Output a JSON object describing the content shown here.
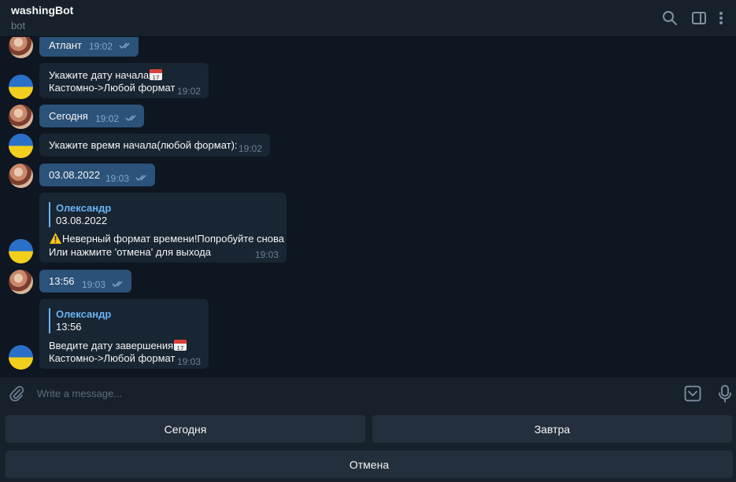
{
  "header": {
    "title": "washingBot",
    "subtitle": "bot"
  },
  "messages": [
    {
      "dir": "out",
      "text": "Атлант",
      "time": "19:02"
    },
    {
      "dir": "in",
      "lines": [
        "Укажите дату начала",
        "Кастомно->Любой формат"
      ],
      "time": "19:02",
      "emoji": "calendar-icon"
    },
    {
      "dir": "out",
      "text": "Сегодня",
      "time": "19:02"
    },
    {
      "dir": "in",
      "lines": [
        "Укажите время начала(любой формат):"
      ],
      "time": "19:02"
    },
    {
      "dir": "out",
      "text": "03.08.2022",
      "time": "19:03"
    },
    {
      "dir": "in",
      "reply_name": "Олександр",
      "reply_text": "03.08.2022",
      "lines": [
        "Неверный формат времени!Попробуйте снова",
        "Или нажмите 'отмена' для выхода"
      ],
      "time": "19:03",
      "emoji": "warning-icon"
    },
    {
      "dir": "out",
      "text": "13:56",
      "time": "19:03"
    },
    {
      "dir": "in",
      "reply_name": "Олександр",
      "reply_text": "13:56",
      "lines": [
        "Введите дату завершения",
        "Кастомно->Любой формат"
      ],
      "time": "19:03",
      "emoji": "calendar-icon"
    }
  ],
  "compose": {
    "placeholder": "Write a message..."
  },
  "keyboard": {
    "row1": [
      "Сегодня",
      "Завтра"
    ],
    "row2": [
      "Отмена"
    ]
  },
  "colors": {
    "background": "#0e1621",
    "panel": "#17212b",
    "bubble_out": "#2b5278",
    "bubble_in": "#182533",
    "accent": "#6ab3f3"
  }
}
